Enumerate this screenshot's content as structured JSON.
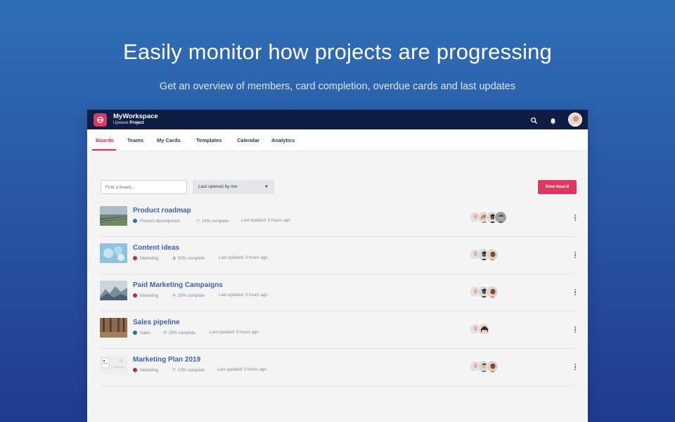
{
  "hero": {
    "title": "Easily monitor how projects are progressing",
    "subtitle": "Get an overview of members, card completion, overdue cards and last updates"
  },
  "workspace": {
    "name": "MyWorkspace",
    "sub_prefix": "Upwave",
    "sub_bold": "Project"
  },
  "topbar": {
    "icons": [
      "search-icon",
      "bell-icon",
      "user-avatar"
    ]
  },
  "nav": {
    "tabs": [
      {
        "label": "Boards",
        "active": true
      },
      {
        "label": "Teams",
        "active": false
      },
      {
        "label": "My Cards",
        "active": false
      },
      {
        "label": "Templates",
        "active": false
      },
      {
        "label": "Calendar",
        "active": false
      },
      {
        "label": "Analytics",
        "active": false
      }
    ]
  },
  "toolbar": {
    "search_placeholder": "Find a board...",
    "sort_value": "Last opened by me",
    "new_board_label": "New board"
  },
  "colors": {
    "accent": "#e0365f",
    "title_blue": "#3a62b8",
    "topbar": "#0f1d45"
  },
  "boards": [
    {
      "title": "Product roadmap",
      "category": "Product development",
      "category_color": "#3566c9",
      "progress_pct": 14,
      "complete": "14% complete",
      "updated": "Last updated: 5 hours ago",
      "members": 4
    },
    {
      "title": "Content ideas",
      "category": "Marketing",
      "category_color": "#c2264f",
      "progress_pct": 50,
      "complete": "50% complete",
      "updated": "Last updated: 3 hours ago",
      "members": 3
    },
    {
      "title": "Paid Marketing Campaigns",
      "category": "Marketing",
      "category_color": "#c2264f",
      "progress_pct": 33,
      "complete": "33% complete",
      "updated": "Last updated: 3 hours ago",
      "members": 3
    },
    {
      "title": "Sales pipeline",
      "category": "Sales",
      "category_color": "#2f6f86",
      "progress_pct": 29,
      "complete": "29% complete",
      "updated": "Last updated: 5 hours ago",
      "members": 2
    },
    {
      "title": "Marketing Plan 2019",
      "category": "Marketing",
      "category_color": "#c2264f",
      "progress_pct": 13,
      "complete": "13% complete",
      "updated": "Last updated: 5 hours ago",
      "members": 3
    }
  ]
}
